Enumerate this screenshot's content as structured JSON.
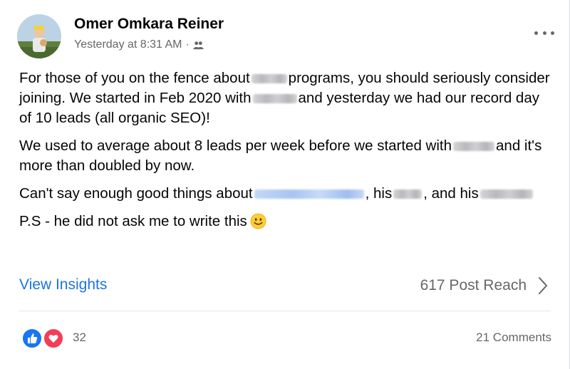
{
  "post": {
    "author": "Omer Omkara Reiner",
    "timestamp": "Yesterday at 8:31 AM",
    "separator": "·",
    "audience_icon": "friends-icon",
    "more_icon": "more-horizontal-icon"
  },
  "body": {
    "p1": {
      "t1": "For those of you on the fence about",
      "t2": "programs, you should seriously consider joining. We started in Feb 2020 with",
      "t3": "and yesterday we had our record day of 10 leads (all organic SEO)!"
    },
    "p2": {
      "t1": "We used to average about 8 leads per week before we started with",
      "t2": "and it's more than doubled by now."
    },
    "p3": {
      "t1": "Can't say enough good things about",
      "t2": ", his",
      "t3": ", and his"
    },
    "p4": {
      "t1": "P.S - he did not ask me to write this"
    },
    "emoji_icon": "slightly-smiling-face-icon"
  },
  "insights": {
    "view_label": "View Insights",
    "reach_label": "617 Post Reach",
    "chevron_icon": "chevron-right-icon"
  },
  "reactions": {
    "types": [
      "like",
      "love"
    ],
    "count": "32",
    "comments_label": "21 Comments"
  },
  "colors": {
    "link_blue": "#1b74e4",
    "secondary_text": "#65676b",
    "like_blue": "#1877f2",
    "love_red": "#f33e58"
  }
}
